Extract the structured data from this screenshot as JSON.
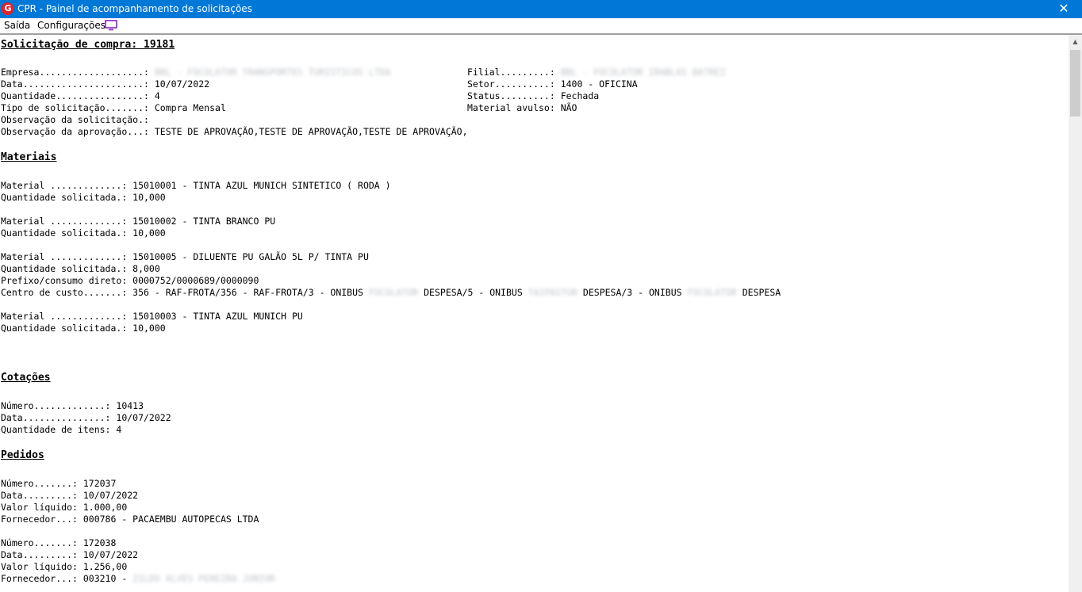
{
  "window": {
    "app_icon_letter": "G",
    "title": "CPR - Painel de acompanhamento de solicitações",
    "close_glyph": "✕"
  },
  "menu": {
    "items": [
      "Saída",
      "Configurações"
    ],
    "monitor_icon_color": "#8b1fc7"
  },
  "solicitacao": {
    "heading": "Solicitação de compra: 19181",
    "empresa_label": "Empresa...................: ",
    "empresa_value": "BBL - FOCOLATOR TRANSPORTES TURISTICOS LTDA",
    "filial_label": "Filial.........: ",
    "filial_value": "BBL - FOCOLATOR IBABLAS BATREZ",
    "data_label": "Data......................: ",
    "data_value": "10/07/2022",
    "setor_label": "Setor..........: ",
    "setor_value": "1400 - OFICINA",
    "quantidade_label": "Quantidade................: ",
    "quantidade_value": "4",
    "status_label": "Status.........: ",
    "status_value": "Fechada",
    "tipo_label": "Tipo de solicitação.......: ",
    "tipo_value": "Compra Mensal",
    "avulso_label": "Material avulso: ",
    "avulso_value": "NÃO",
    "obs_solicitacao": "Observação da solicitação.:",
    "obs_aprovacao_label": "Observação da aprovação...: ",
    "obs_aprovacao_value": "TESTE DE APROVAÇÃO,TESTE DE APROVAÇÃO,TESTE DE APROVAÇÃO,"
  },
  "materiais": {
    "heading": "Materiais",
    "m1_material": "Material .............: 15010001 - TINTA AZUL MUNICH SINTETICO ( RODA )",
    "m1_qtd": "Quantidade solicitada.: 10,000",
    "m2_material": "Material .............: 15010002 - TINTA BRANCO PU",
    "m2_qtd": "Quantidade solicitada.: 10,000",
    "m3_material": "Material .............: 15010005 - DILUENTE PU GALÃO 5L P/ TINTA PU",
    "m3_qtd": "Quantidade solicitada.: 8,000",
    "m3_prefixo": "Prefixo/consumo direto: 0000752/0000689/0000090",
    "m3_cc_a": "Centro de custo.......: 356 - RAF-FROTA/356 - RAF-FROTA/3 - ONIBUS ",
    "m3_cc_b1": "FOCOLATOR",
    "m3_cc_c": " DESPESA/5 - ONIBUS ",
    "m3_cc_b2": "TAIPASTUR",
    "m3_cc_d": " DESPESA/3 - ONIBUS ",
    "m3_cc_b3": "FOCOLATOR",
    "m3_cc_e": " DESPESA",
    "m4_material": "Material .............: 15010003 - TINTA AZUL MUNICH PU",
    "m4_qtd": "Quantidade solicitada.: 10,000"
  },
  "cotacoes": {
    "heading": "Cotações",
    "numero": "Número.............: 10413",
    "data": "Data...............: 10/07/2022",
    "qtd_itens": "Quantidade de itens: 4"
  },
  "pedidos": {
    "heading": "Pedidos",
    "p1_numero": "Número.......: 172037",
    "p1_data": "Data.........: 10/07/2022",
    "p1_valor": "Valor líquido: 1.000,00",
    "p1_fornecedor": "Fornecedor...: 000786 - PACAEMBU AUTOPECAS LTDA",
    "p2_numero": "Número.......: 172038",
    "p2_data": "Data.........: 10/07/2022",
    "p2_valor": "Valor líquido: 1.256,00",
    "p2_fornecedor_label": "Fornecedor...: 003210 - ",
    "p2_fornecedor_value": "ZILDO ALVES PEREIRA JUNIOR"
  }
}
